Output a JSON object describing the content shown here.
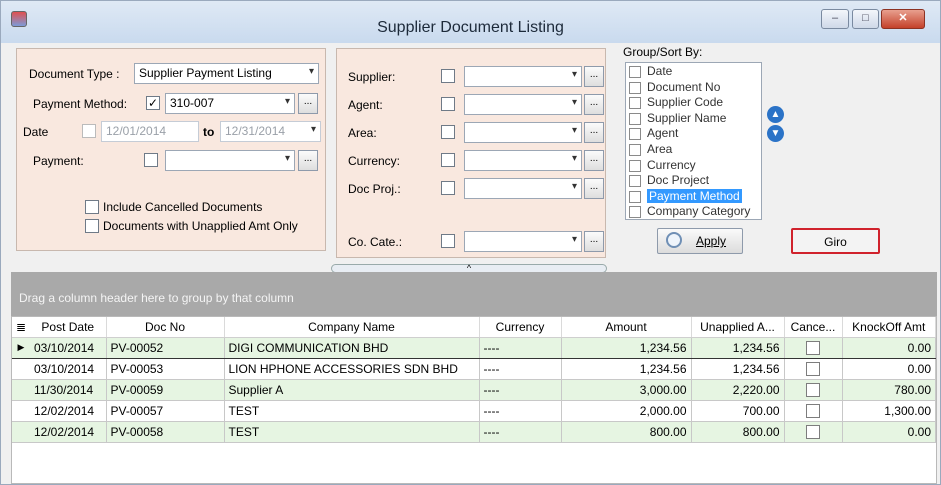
{
  "window": {
    "title": "Supplier Document Listing",
    "min_glyph": "–",
    "max_glyph": "□",
    "close_glyph": "✕"
  },
  "filters_left": {
    "document_type_label": "Document Type :",
    "document_type_value": "Supplier Payment Listing",
    "payment_method_label": "Payment Method:",
    "payment_method_checked": true,
    "payment_method_value": "310-007",
    "date_label": "Date",
    "date_from": "12/01/2014",
    "date_to_label": "to",
    "date_to": "12/31/2014",
    "payment_label": "Payment:",
    "payment_value": "",
    "include_cancelled_label": "Include Cancelled Documents",
    "unapplied_only_label": "Documents with Unapplied Amt Only"
  },
  "filters_middle": {
    "supplier_label": "Supplier:",
    "agent_label": "Agent:",
    "area_label": "Area:",
    "currency_label": "Currency:",
    "doc_proj_label": "Doc Proj.:",
    "co_cate_label": "Co. Cate.:"
  },
  "group_sort": {
    "label": "Group/Sort By:",
    "items": [
      "Date",
      "Document No",
      "Supplier Code",
      "Supplier Name",
      "Agent",
      "Area",
      "Currency",
      "Doc Project",
      "Payment Method",
      "Company Category"
    ],
    "selected_index": 8
  },
  "buttons": {
    "apply": "Apply",
    "giro": "Giro",
    "ellipsis": "...",
    "dropdown_glyph": "▾",
    "splitter_glyph": "^"
  },
  "grid": {
    "group_hint": "Drag a column header here to group by that column",
    "columns": [
      "Post Date",
      "Doc No",
      "Company Name",
      "Currency",
      "Amount",
      "Unapplied A...",
      "Cance...",
      "KnockOff Amt"
    ],
    "rows": [
      [
        "03/10/2014",
        "PV-00052",
        "DIGI COMMUNICATION BHD",
        "----",
        "1,234.56",
        "1,234.56",
        "",
        "0.00"
      ],
      [
        "03/10/2014",
        "PV-00053",
        "LION HPHONE ACCESSORIES SDN BHD",
        "----",
        "1,234.56",
        "1,234.56",
        "",
        "0.00"
      ],
      [
        "11/30/2014",
        "PV-00059",
        "Supplier A",
        "----",
        "3,000.00",
        "2,220.00",
        "",
        "780.00"
      ],
      [
        "12/02/2014",
        "PV-00057",
        "TEST",
        "----",
        "2,000.00",
        "700.00",
        "",
        "1,300.00"
      ],
      [
        "12/02/2014",
        "PV-00058",
        "TEST",
        "----",
        "800.00",
        "800.00",
        "",
        "0.00"
      ]
    ]
  }
}
